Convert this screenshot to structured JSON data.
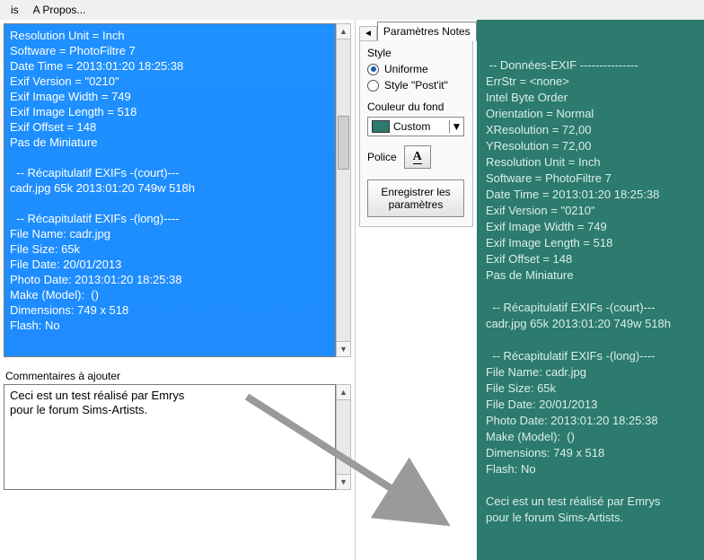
{
  "menu": {
    "item1": "is",
    "item2": "A Propos..."
  },
  "exif_text": "Resolution Unit = Inch\nSoftware = PhotoFiltre 7\nDate Time = 2013:01:20 18:25:38\nExif Version = \"0210\"\nExif Image Width = 749\nExif Image Length = 518\nExif Offset = 148\nPas de Miniature\n\n  -- Récapitulatif EXIFs -(court)---\ncadr.jpg 65k 2013:01:20 749w 518h\n\n  -- Récapitulatif EXIFs -(long)----\nFile Name: cadr.jpg\nFile Size: 65k\nFile Date: 20/01/2013\nPhoto Date: 2013:01:20 18:25:38\nMake (Model):  ()\nDimensions: 749 x 518\nFlash: No",
  "comments": {
    "label": "Commentaires à ajouter",
    "text": "Ceci est un test réalisé par Emrys\npour le forum Sims-Artists."
  },
  "tabs": {
    "nav_left": "◄",
    "active": "Paramètres Notes"
  },
  "panel": {
    "style_label": "Style",
    "radio_uniforme": "Uniforme",
    "radio_postit": "Style \"Post'it\"",
    "bgcolor_label": "Couleur du fond",
    "color_name": "Custom",
    "color_hex": "#2d7a6f",
    "police_label": "Police",
    "font_btn": "A",
    "save_btn": "Enregistrer les paramètres"
  },
  "preview_text": " -- Données-EXIF ---------------\nErrStr = <none>\nIntel Byte Order\nOrientation = Normal\nXResolution = 72,00\nYResolution = 72,00\nResolution Unit = Inch\nSoftware = PhotoFiltre 7\nDate Time = 2013:01:20 18:25:38\nExif Version = \"0210\"\nExif Image Width = 749\nExif Image Length = 518\nExif Offset = 148\nPas de Miniature\n\n  -- Récapitulatif EXIFs -(court)---\ncadr.jpg 65k 2013:01:20 749w 518h\n\n  -- Récapitulatif EXIFs -(long)----\nFile Name: cadr.jpg\nFile Size: 65k\nFile Date: 20/01/2013\nPhoto Date: 2013:01:20 18:25:38\nMake (Model):  ()\nDimensions: 749 x 518\nFlash: No\n\nCeci est un test réalisé par Emrys\npour le forum Sims-Artists."
}
